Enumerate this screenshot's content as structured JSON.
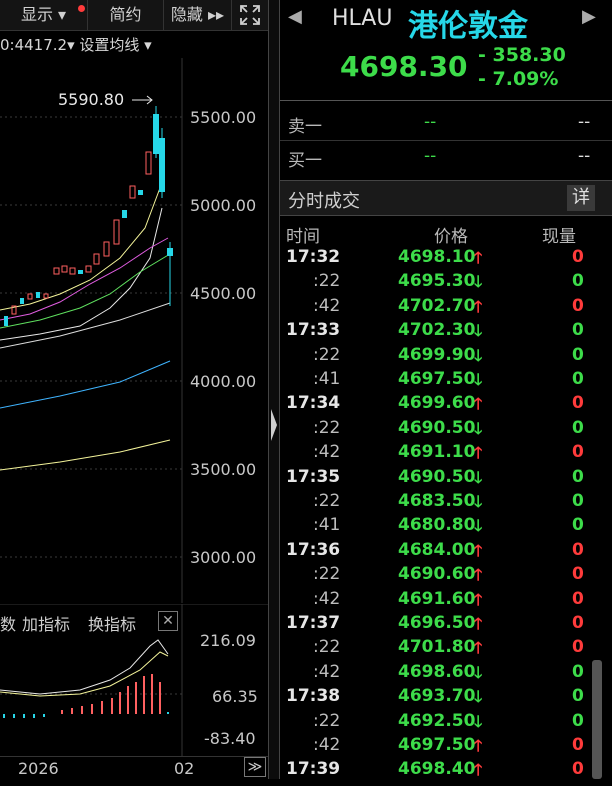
{
  "toolbar": {
    "show_label": "显示 ▾",
    "simple_label": "简约",
    "hide_label": "隐藏 ▸▸",
    "expand_icon": "expand-icon"
  },
  "ma_info": {
    "text": "0:4417.2▾ 设置均线 ▾"
  },
  "price_axis": {
    "labels": [
      "5500.00",
      "5000.00",
      "4500.00",
      "4000.00",
      "3500.00",
      "3000.00"
    ],
    "max_label": "5590.80"
  },
  "indicator": {
    "tab_partial": "数",
    "add_label": "加指标",
    "switch_label": "换指标",
    "close": "✕",
    "axis_labels": [
      "216.09",
      "66.35",
      "-83.40"
    ]
  },
  "dates": {
    "year": "2026",
    "month": "02",
    "more": "≫"
  },
  "quote": {
    "symbol": "HLAU",
    "name": "港伦敦金",
    "price": "4698.30",
    "change": "- 358.30",
    "change_pct": "- 7.09%",
    "nav_left": "◀",
    "nav_right": "▶"
  },
  "orderbook": {
    "sell1_label": "卖一",
    "sell1_price": "--",
    "sell1_vol": "--",
    "buy1_label": "买一",
    "buy1_price": "--",
    "buy1_vol": "--"
  },
  "ticks_panel": {
    "title": "分时成交",
    "detail_button": "详",
    "col_time": "时间",
    "col_price": "价格",
    "col_vol": "现量",
    "up_arrow": "🡑",
    "down_arrow": "🡓",
    "rows": [
      {
        "time": "17:32",
        "price": "4698.10",
        "dir": "up",
        "vol": "0"
      },
      {
        "time": ":22",
        "price": "4695.30",
        "dir": "down",
        "vol": "0"
      },
      {
        "time": ":42",
        "price": "4702.70",
        "dir": "up",
        "vol": "0"
      },
      {
        "time": "17:33",
        "price": "4702.30",
        "dir": "down",
        "vol": "0"
      },
      {
        "time": ":22",
        "price": "4699.90",
        "dir": "down",
        "vol": "0"
      },
      {
        "time": ":41",
        "price": "4697.50",
        "dir": "down",
        "vol": "0"
      },
      {
        "time": "17:34",
        "price": "4699.60",
        "dir": "up",
        "vol": "0"
      },
      {
        "time": ":22",
        "price": "4690.50",
        "dir": "down",
        "vol": "0"
      },
      {
        "time": ":42",
        "price": "4691.10",
        "dir": "up",
        "vol": "0"
      },
      {
        "time": "17:35",
        "price": "4690.50",
        "dir": "down",
        "vol": "0"
      },
      {
        "time": ":22",
        "price": "4683.50",
        "dir": "down",
        "vol": "0"
      },
      {
        "time": ":41",
        "price": "4680.80",
        "dir": "down",
        "vol": "0"
      },
      {
        "time": "17:36",
        "price": "4684.00",
        "dir": "up",
        "vol": "0"
      },
      {
        "time": ":22",
        "price": "4690.60",
        "dir": "up",
        "vol": "0"
      },
      {
        "time": ":42",
        "price": "4691.60",
        "dir": "up",
        "vol": "0"
      },
      {
        "time": "17:37",
        "price": "4696.50",
        "dir": "up",
        "vol": "0"
      },
      {
        "time": ":22",
        "price": "4701.80",
        "dir": "up",
        "vol": "0"
      },
      {
        "time": ":42",
        "price": "4698.60",
        "dir": "down",
        "vol": "0"
      },
      {
        "time": "17:38",
        "price": "4693.70",
        "dir": "down",
        "vol": "0"
      },
      {
        "time": ":22",
        "price": "4692.50",
        "dir": "down",
        "vol": "0"
      },
      {
        "time": ":42",
        "price": "4697.50",
        "dir": "up",
        "vol": "0"
      },
      {
        "time": "17:39",
        "price": "4698.40",
        "dir": "up",
        "vol": "0"
      }
    ]
  },
  "colors": {
    "up": "#ff3b3b",
    "down": "#3ddc4a",
    "accent": "#26d7e8",
    "ma_yellow": "#f4f49a",
    "ma_magenta": "#e05ce0",
    "ma_green": "#5fe05f",
    "ma_blue": "#3fb4ff"
  }
}
